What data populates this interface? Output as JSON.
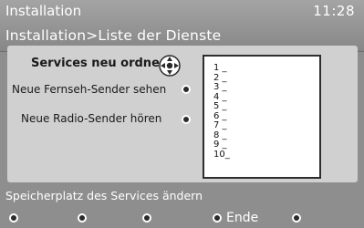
{
  "header": {
    "title": "Installation",
    "clock": "11:28",
    "breadcrumb": "Installation>Liste der Dienste"
  },
  "panel": {
    "title": "Services neu ordnen",
    "nav_icon": "cursor-cross-icon",
    "items": [
      {
        "label": "Neue Fernseh-Sender sehen",
        "icon": "radio-dot-icon"
      },
      {
        "label": "Neue Radio-Sender hören",
        "icon": "radio-dot-icon"
      }
    ]
  },
  "service_list": [
    "1 _",
    "2 _",
    "3 _",
    "4 _",
    "5 _",
    "6 _",
    "7 _",
    "8 _",
    "9 _",
    "10_"
  ],
  "hint": "Speicherplatz des Services ändern",
  "footer": {
    "buttons": [
      {
        "label": ""
      },
      {
        "label": ""
      },
      {
        "label": ""
      },
      {
        "label": "Ende"
      },
      {
        "label": ""
      }
    ]
  },
  "colors": {
    "background": "#8e8e8e",
    "panel": "#d0d0d0",
    "list_box": "#ffffff",
    "text_light": "#ffffff",
    "text_dark": "#1a1a1a"
  }
}
